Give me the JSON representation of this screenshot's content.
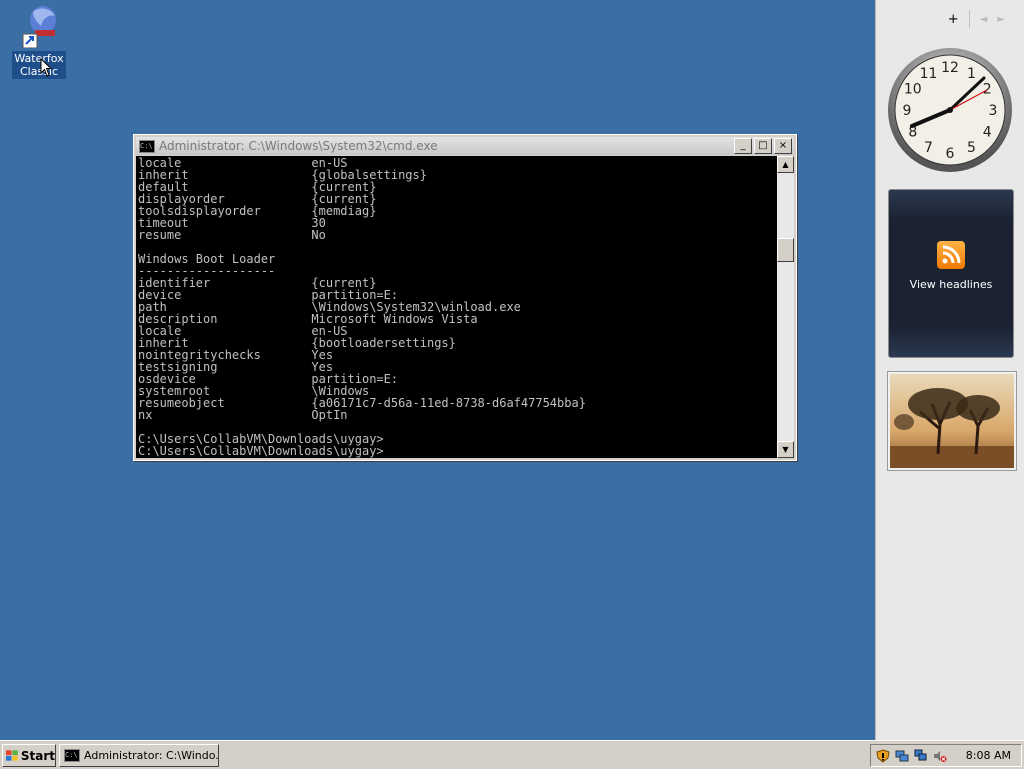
{
  "desktop": {
    "icon_label": "Waterfox Classic"
  },
  "cmd_window": {
    "title": "Administrator: C:\\Windows\\System32\\cmd.exe",
    "icon_text": "C:\\",
    "buttons": {
      "minimize": "_",
      "maximize": "□",
      "close": "×"
    },
    "console_lines": [
      "locale                  en-US",
      "inherit                 {globalsettings}",
      "default                 {current}",
      "displayorder            {current}",
      "toolsdisplayorder       {memdiag}",
      "timeout                 30",
      "resume                  No",
      "",
      "Windows Boot Loader",
      "-------------------",
      "identifier              {current}",
      "device                  partition=E:",
      "path                    \\Windows\\System32\\winload.exe",
      "description             Microsoft Windows Vista",
      "locale                  en-US",
      "inherit                 {bootloadersettings}",
      "nointegritychecks       Yes",
      "testsigning             Yes",
      "osdevice                partition=E:",
      "systemroot              \\Windows",
      "resumeobject            {a06171c7-d56a-11ed-8738-d6af47754bba}",
      "nx                      OptIn",
      "",
      "C:\\Users\\CollabVM\\Downloads\\uygay>",
      "C:\\Users\\CollabVM\\Downloads\\uygay>"
    ]
  },
  "sidebar": {
    "add_gadget": "+",
    "prev": "◄",
    "next": "►",
    "clock_numbers": [
      "12",
      "1",
      "2",
      "3",
      "4",
      "5",
      "6",
      "7",
      "8",
      "9",
      "10",
      "11"
    ],
    "feed_label": "View headlines"
  },
  "taskbar": {
    "start_label": "Start",
    "task_label": "Administrator: C:\\Windo...",
    "clock": "8:08 AM"
  },
  "colors": {
    "desktop": "#3a6ea5",
    "rss": "#f07800"
  },
  "icons": [
    "waterfox-icon",
    "cmd-icon",
    "windows-flag-icon",
    "rss-icon",
    "shield-icon",
    "network-icon",
    "speaker-muted-icon"
  ]
}
